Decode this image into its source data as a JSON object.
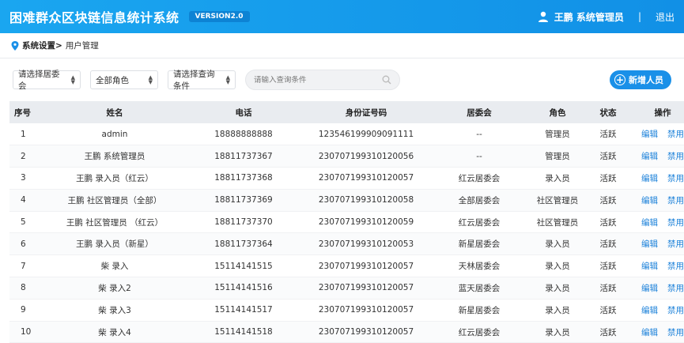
{
  "header": {
    "app_title": "困难群众区块链信息统计系统",
    "version": "VERSION2.0",
    "user_name": "王鹏 系统管理员",
    "separator": "|",
    "logout": "退出"
  },
  "breadcrumb": {
    "section": "系统设置>",
    "current": "用户管理"
  },
  "filters": {
    "community": "请选择居委会",
    "role": "全部角色",
    "query_type": "请选择查询条件",
    "search_placeholder": "请输入查询条件",
    "add_button": "新增人员"
  },
  "table": {
    "columns": [
      "序号",
      "姓名",
      "电话",
      "身份证号码",
      "居委会",
      "角色",
      "状态",
      "操作"
    ],
    "edit_label": "编辑",
    "disable_label": "禁用",
    "rows": [
      {
        "idx": "1",
        "name": "admin",
        "phone": "18888888888",
        "id": "123546199909091111",
        "community": "--",
        "role": "管理员",
        "status": "活跃"
      },
      {
        "idx": "2",
        "name": "王鹏 系统管理员",
        "phone": "18811737367",
        "id": "230707199310120056",
        "community": "--",
        "role": "管理员",
        "status": "活跃"
      },
      {
        "idx": "3",
        "name": "王鹏 录入员（红云）",
        "phone": "18811737368",
        "id": "230707199310120057",
        "community": "红云居委会",
        "role": "录入员",
        "status": "活跃"
      },
      {
        "idx": "4",
        "name": "王鹏 社区管理员（全部）",
        "phone": "18811737369",
        "id": "230707199310120058",
        "community": "全部居委会",
        "role": "社区管理员",
        "status": "活跃"
      },
      {
        "idx": "5",
        "name": "王鹏 社区管理员 （红云）",
        "phone": "18811737370",
        "id": "230707199310120059",
        "community": "红云居委会",
        "role": "社区管理员",
        "status": "活跃"
      },
      {
        "idx": "6",
        "name": "王鹏 录入员（新星）",
        "phone": "18811737364",
        "id": "230707199310120053",
        "community": "新星居委会",
        "role": "录入员",
        "status": "活跃"
      },
      {
        "idx": "7",
        "name": "柴 录入",
        "phone": "15114141515",
        "id": "230707199310120057",
        "community": "天林居委会",
        "role": "录入员",
        "status": "活跃"
      },
      {
        "idx": "8",
        "name": "柴 录入2",
        "phone": "15114141516",
        "id": "230707199310120057",
        "community": "蓝天居委会",
        "role": "录入员",
        "status": "活跃"
      },
      {
        "idx": "9",
        "name": "柴 录入3",
        "phone": "15114141517",
        "id": "230707199310120057",
        "community": "新星居委会",
        "role": "录入员",
        "status": "活跃"
      },
      {
        "idx": "10",
        "name": "柴 录入4",
        "phone": "15114141518",
        "id": "230707199310120057",
        "community": "红云居委会",
        "role": "录入员",
        "status": "活跃"
      }
    ]
  },
  "colors": {
    "primary": "#1a90e8",
    "header_bg": "#1aa6f0",
    "link": "#1a80d9"
  }
}
